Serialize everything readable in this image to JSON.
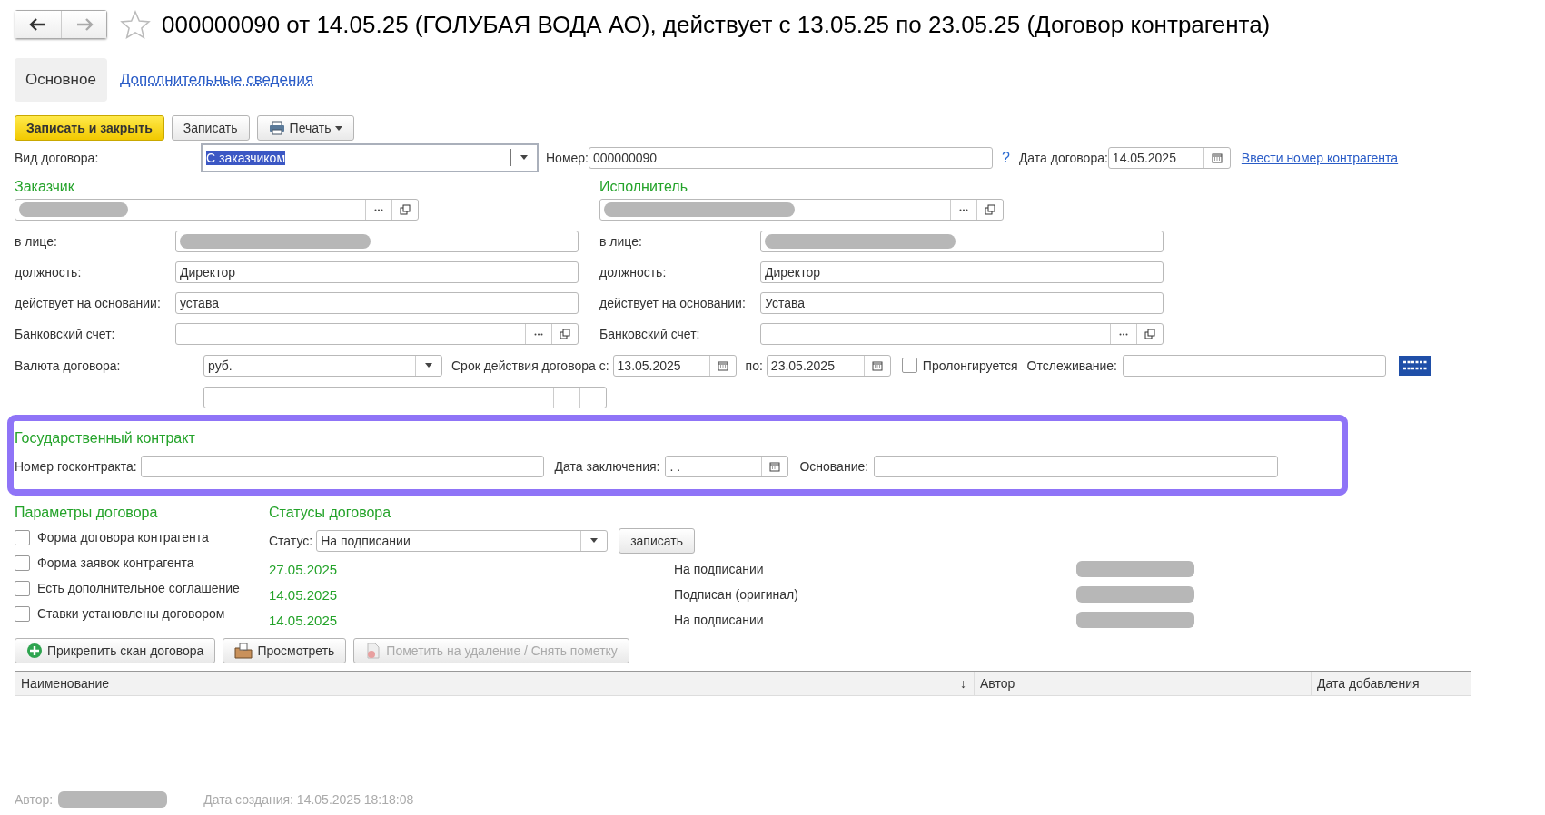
{
  "title": "000000090 от 14.05.25 (ГОЛУБАЯ ВОДА АО), действует с 13.05.25 по 23.05.25 (Договор контрагента)",
  "tabs": [
    {
      "label": "Основное",
      "selected": true
    },
    {
      "label": "Дополнительные сведения",
      "selected": false
    }
  ],
  "toolbar": {
    "save_close": "Записать и закрыть",
    "save": "Записать",
    "print": "Печать"
  },
  "contract_type": {
    "label": "Вид договора:",
    "value": "С заказчиком"
  },
  "number": {
    "label": "Номер:",
    "value": "000000090",
    "help": "?"
  },
  "contract_date": {
    "label": "Дата договора:",
    "value": "14.05.2025"
  },
  "enter_number_link": "Ввести номер контрагента",
  "parties": [
    {
      "heading": "Заказчик",
      "rows": [
        {
          "label": "в лице:",
          "kind": "redacted"
        },
        {
          "label": "должность:",
          "kind": "text",
          "value": "Директор"
        },
        {
          "label": "действует на основании:",
          "kind": "text",
          "value": "устава"
        },
        {
          "label": "Банковский счет:",
          "kind": "ref"
        }
      ]
    },
    {
      "heading": "Исполнитель",
      "rows": [
        {
          "label": "в лице:",
          "kind": "redacted"
        },
        {
          "label": "должность:",
          "kind": "text",
          "value": "Директор"
        },
        {
          "label": "действует на основании:",
          "kind": "text",
          "value": "Устава"
        },
        {
          "label": "Банковский счет:",
          "kind": "ref"
        }
      ]
    }
  ],
  "currency": {
    "label": "Валюта договора:",
    "value": "руб."
  },
  "period": {
    "from_label": "Срок действия договора с:",
    "from": "13.05.2025",
    "to_label": "по:",
    "to": "23.05.2025"
  },
  "prolong": {
    "label": "Пролонгируется",
    "checked": false
  },
  "tracking": {
    "label": "Отслеживание:"
  },
  "gov_contract": {
    "heading": "Государственный контракт",
    "number_label": "Номер госконтракта:",
    "date_label": "Дата заключения:",
    "date_value": ". .",
    "basis_label": "Основание:"
  },
  "params": {
    "heading": "Параметры договора",
    "items": [
      {
        "label": "Форма договора контрагента",
        "checked": false
      },
      {
        "label": "Форма заявок контрагента",
        "checked": false
      },
      {
        "label": "Есть дополнительное соглашение",
        "checked": false
      },
      {
        "label": "Ставки установлены договором",
        "checked": false
      }
    ]
  },
  "statuses": {
    "heading": "Статусы договора",
    "status_label": "Статус:",
    "status_value": "На подписании",
    "save_button": "записать",
    "history": [
      {
        "date": "27.05.2025",
        "status": "На подписании"
      },
      {
        "date": "14.05.2025",
        "status": "Подписан (оригинал)"
      },
      {
        "date": "14.05.2025",
        "status": "На подписании"
      }
    ]
  },
  "file_buttons": [
    {
      "label": "Прикрепить скан договора",
      "kind": "attach",
      "disabled": false
    },
    {
      "label": "Просмотреть",
      "kind": "view",
      "disabled": false
    },
    {
      "label": "Пометить на удаление / Снять пометку",
      "kind": "delete",
      "disabled": true
    }
  ],
  "table": {
    "columns": [
      {
        "label": "Наименование",
        "sort": "↓"
      },
      {
        "label": "Автор"
      },
      {
        "label": "Дата добавления"
      }
    ]
  },
  "footer": {
    "author_label": "Автор:",
    "created": "Дата создания: 14.05.2025 18:18:08"
  }
}
